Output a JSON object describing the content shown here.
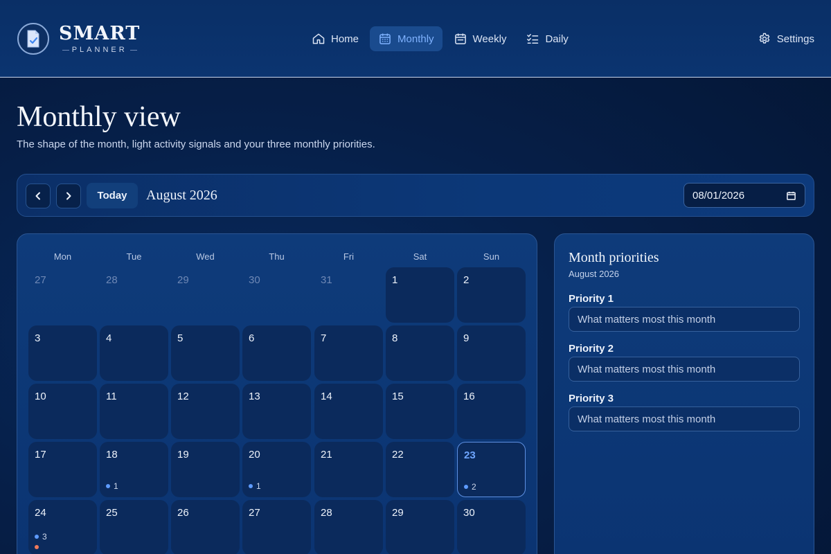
{
  "brand": {
    "name": "SMART",
    "sub": "PLANNER"
  },
  "nav": {
    "home": "Home",
    "monthly": "Monthly",
    "weekly": "Weekly",
    "daily": "Daily",
    "settings": "Settings",
    "active": "Monthly"
  },
  "page": {
    "title": "Monthly view",
    "subtitle": "The shape of the month, light activity signals and your three monthly priorities."
  },
  "toolbar": {
    "today": "Today",
    "month_label": "August 2026",
    "date_value": "08/01/2026"
  },
  "calendar": {
    "weekdays": [
      "Mon",
      "Tue",
      "Wed",
      "Thu",
      "Fri",
      "Sat",
      "Sun"
    ],
    "rows": [
      [
        {
          "day": "27",
          "outside": true
        },
        {
          "day": "28",
          "outside": true
        },
        {
          "day": "29",
          "outside": true
        },
        {
          "day": "30",
          "outside": true
        },
        {
          "day": "31",
          "outside": true
        },
        {
          "day": "1"
        },
        {
          "day": "2"
        }
      ],
      [
        {
          "day": "3"
        },
        {
          "day": "4"
        },
        {
          "day": "5"
        },
        {
          "day": "6"
        },
        {
          "day": "7"
        },
        {
          "day": "8"
        },
        {
          "day": "9"
        }
      ],
      [
        {
          "day": "10"
        },
        {
          "day": "11"
        },
        {
          "day": "12"
        },
        {
          "day": "13"
        },
        {
          "day": "14"
        },
        {
          "day": "15"
        },
        {
          "day": "16"
        }
      ],
      [
        {
          "day": "17"
        },
        {
          "day": "18",
          "signal": "1"
        },
        {
          "day": "19"
        },
        {
          "day": "20",
          "signal": "1"
        },
        {
          "day": "21"
        },
        {
          "day": "22"
        },
        {
          "day": "23",
          "signal": "2",
          "today": true
        }
      ],
      [
        {
          "day": "24",
          "signal": "3",
          "extra_dot": true
        },
        {
          "day": "25"
        },
        {
          "day": "26"
        },
        {
          "day": "27"
        },
        {
          "day": "28"
        },
        {
          "day": "29"
        },
        {
          "day": "30"
        }
      ]
    ]
  },
  "priorities": {
    "title": "Month priorities",
    "subtitle": "August 2026",
    "items": [
      {
        "label": "Priority 1",
        "placeholder": "What matters most this month"
      },
      {
        "label": "Priority 2",
        "placeholder": "What matters most this month"
      },
      {
        "label": "Priority 3",
        "placeholder": "What matters most this month"
      }
    ]
  },
  "colors": {
    "accent": "#7fb2ff",
    "signal_dot": "#5e9bff",
    "signal_dot_alt": "#f07a5a"
  }
}
